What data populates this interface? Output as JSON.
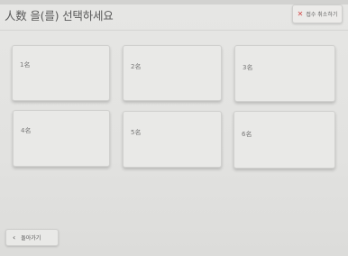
{
  "page": {
    "title": "人数 을(를) 선택하세요"
  },
  "header": {
    "cancel_label": "접수 취소하기",
    "cancel_icon": "close-icon",
    "cancel_icon_color": "#d24a4a"
  },
  "options": [
    {
      "label": "1名"
    },
    {
      "label": "2名"
    },
    {
      "label": "3名"
    },
    {
      "label": "4名"
    },
    {
      "label": "5名"
    },
    {
      "label": "6名"
    }
  ],
  "footer": {
    "back_label": "돌아가기",
    "back_icon": "chevron-left-icon"
  }
}
